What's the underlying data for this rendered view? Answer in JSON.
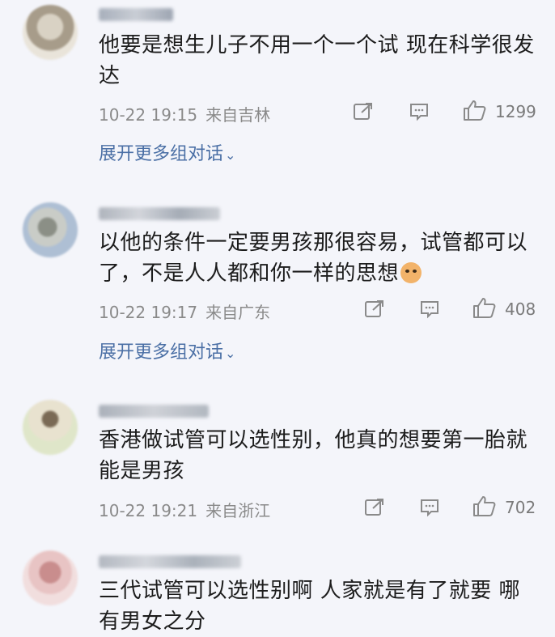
{
  "comments": [
    {
      "text": "他要是想生儿子不用一个一个试 现在科学很发达",
      "time": "10-22 19:15",
      "location": "来自吉林",
      "likes": "1299",
      "expand": "展开更多组对话"
    },
    {
      "text": "以他的条件一定要男孩那很容易，试管都可以了，不是人人都和你一样的思想",
      "time": "10-22 19:17",
      "location": "来自广东",
      "likes": "408",
      "expand": "展开更多组对话"
    },
    {
      "text": "香港做试管可以选性别，他真的想要第一胎就能是男孩",
      "time": "10-22 19:21",
      "location": "来自浙江",
      "likes": "702"
    },
    {
      "text": "三代试管可以选性别啊 人家就是有了就要 哪有男女之分"
    }
  ],
  "icons": {
    "share": "share-icon",
    "reply": "comment-icon",
    "like": "thumbs-up-icon",
    "expand_chevron": "chevron-down-icon",
    "emoji": "cat-face-emoji-icon"
  },
  "colors": {
    "background": "#f4f5fa",
    "link": "#4a6fa5",
    "meta": "#8a8a8a"
  }
}
